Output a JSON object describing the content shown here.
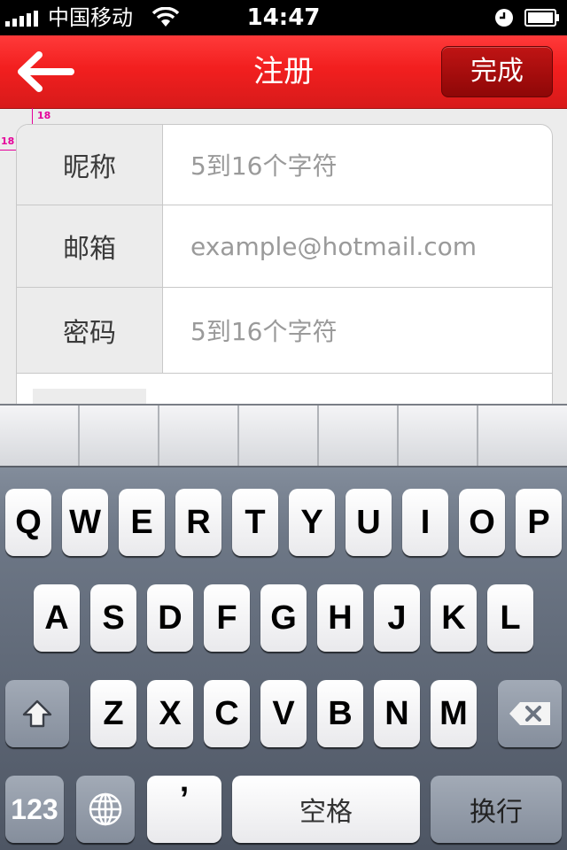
{
  "status_bar": {
    "carrier": "中国移动",
    "time": "14:47"
  },
  "nav": {
    "title": "注册",
    "done_label": "完成"
  },
  "guides": {
    "top_label": "18",
    "left_label": "18"
  },
  "form": {
    "rows": [
      {
        "label": "昵称",
        "placeholder": "5到16个字符"
      },
      {
        "label": "邮箱",
        "placeholder": "example@hotmail.com"
      },
      {
        "label": "密码",
        "placeholder": "5到16个字符"
      }
    ]
  },
  "keyboard": {
    "row1": [
      "Q",
      "W",
      "E",
      "R",
      "T",
      "Y",
      "U",
      "I",
      "O",
      "P"
    ],
    "row2": [
      "A",
      "S",
      "D",
      "F",
      "G",
      "H",
      "J",
      "K",
      "L"
    ],
    "row3": [
      "Z",
      "X",
      "C",
      "V",
      "B",
      "N",
      "M"
    ],
    "numbers_label": "123",
    "apostrophe_label": "’",
    "space_label": "空格",
    "return_label": "换行"
  },
  "colors": {
    "nav_red": "#f21f1f",
    "done_dark_red": "#8e0707",
    "guide_magenta": "#e5009a"
  }
}
